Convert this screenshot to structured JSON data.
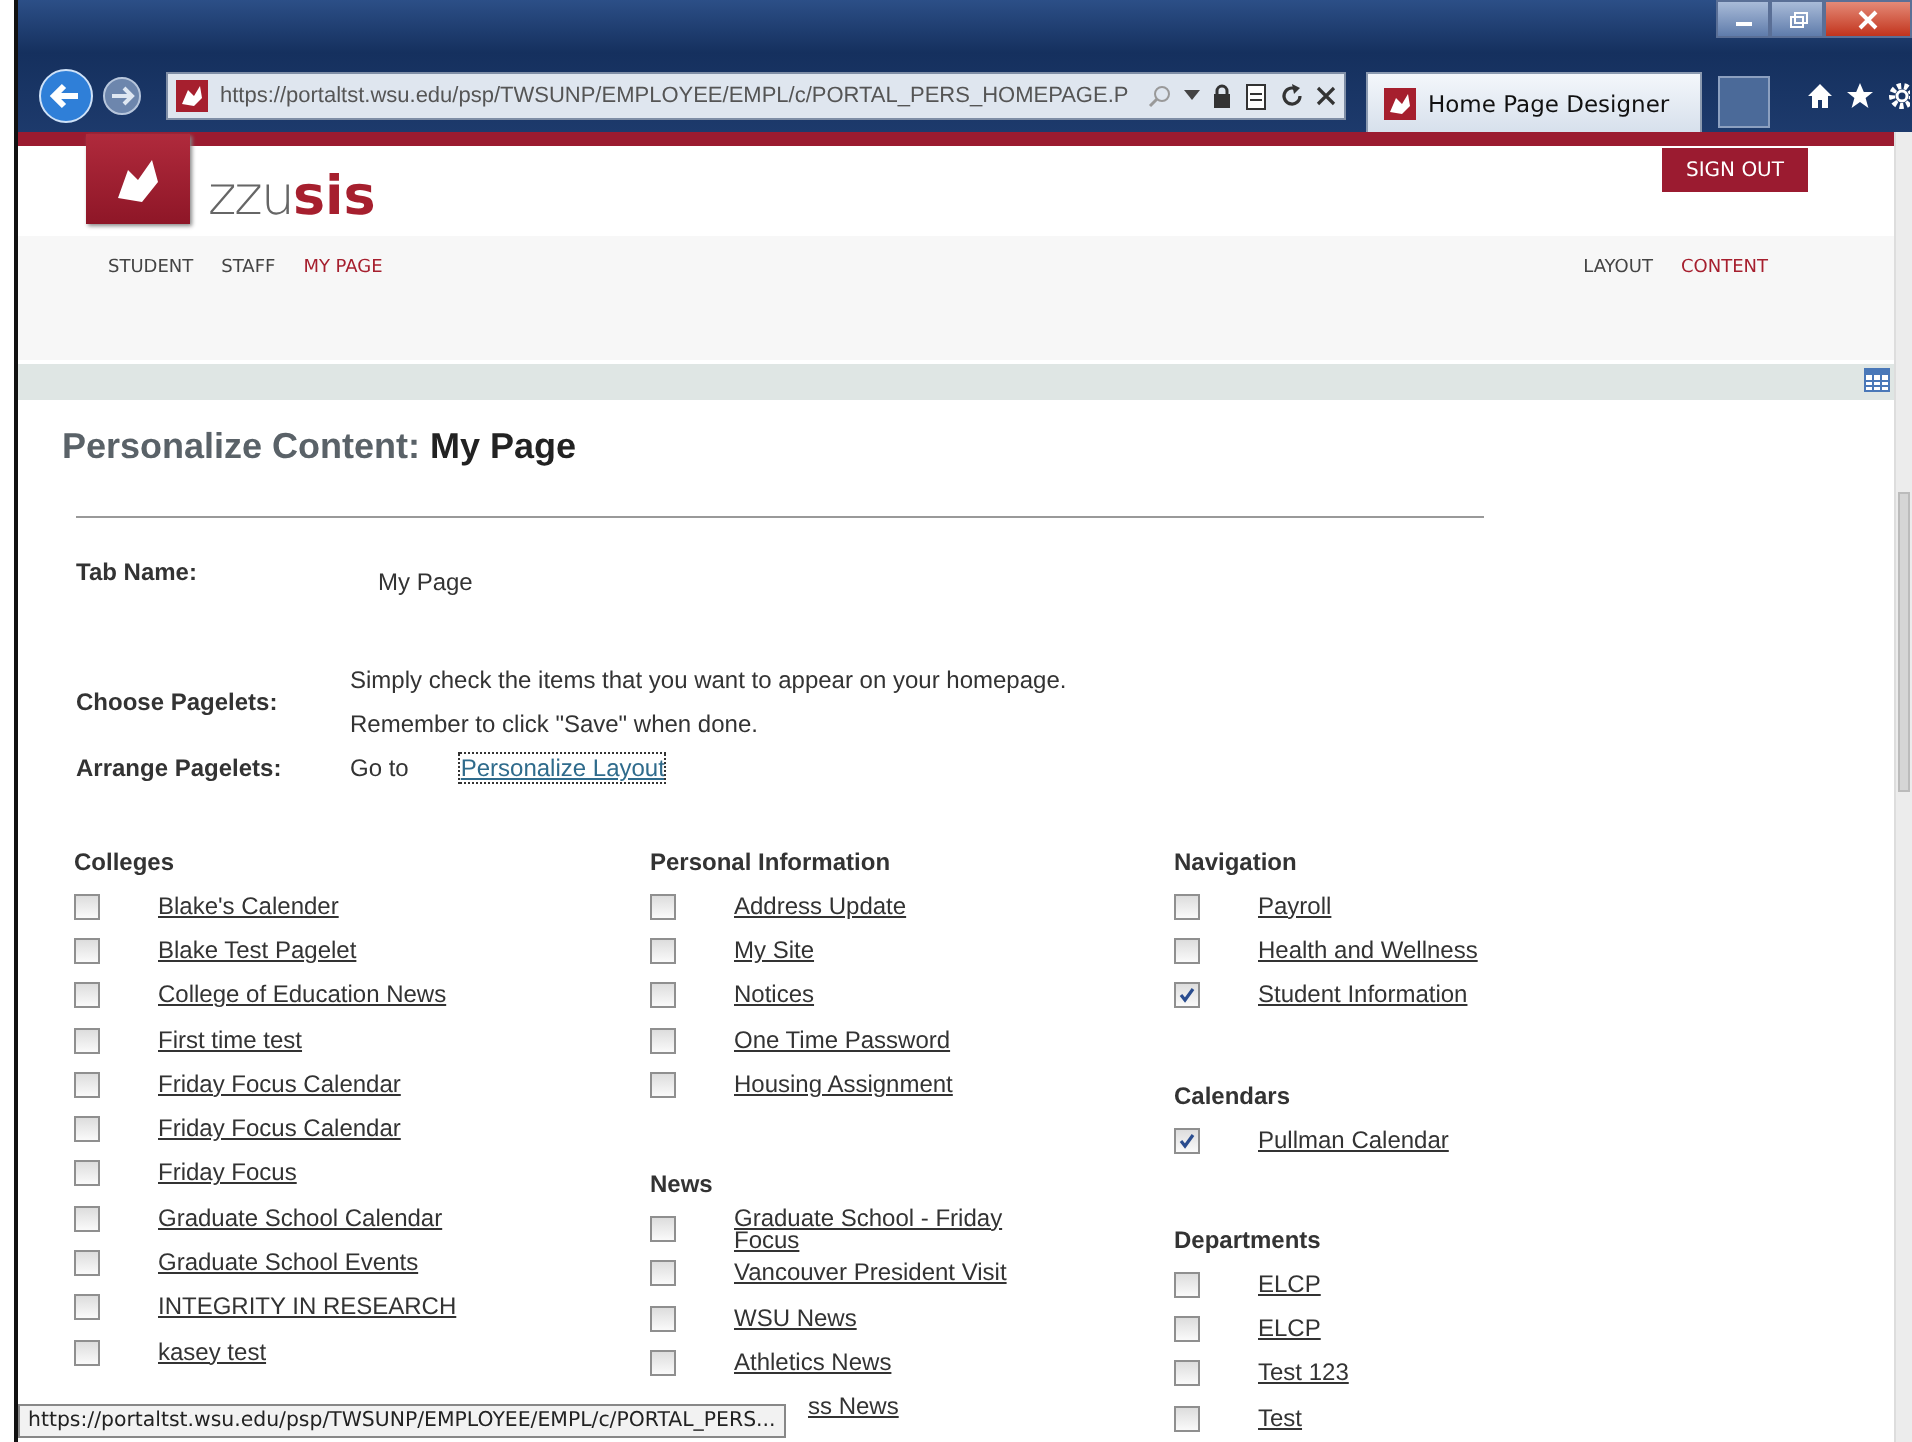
{
  "browser": {
    "address": "https://portaltst.wsu.edu/psp/TWSUNP/EMPLOYEE/EMPL/c/PORTAL_PERS_HOMEPAGE.P",
    "tab": {
      "label": "Home Page Designer",
      "selected": true
    }
  },
  "header": {
    "logo_light": "zzu",
    "logo_bold": "sis",
    "sign_out": "SIGN OUT"
  },
  "nav": {
    "left": [
      {
        "label": "STUDENT",
        "selected": false
      },
      {
        "label": "STAFF",
        "selected": false
      },
      {
        "label": "MY PAGE",
        "selected": true
      }
    ],
    "right": [
      {
        "label": "LAYOUT",
        "selected": false
      },
      {
        "label": "CONTENT",
        "selected": true
      }
    ]
  },
  "page": {
    "title_prefix": "Personalize Content:",
    "title_name": "My Page",
    "tab_name": {
      "label": "Tab Name:",
      "value": "My Page"
    },
    "choose": {
      "label": "Choose Pagelets:",
      "lines": [
        "Simply check the items that you want to appear on your homepage.",
        "Remember to click \"Save\" when done."
      ]
    },
    "arrange": {
      "label": "Arrange Pagelets:",
      "text": "Go to",
      "link": "Personalize Layout"
    }
  },
  "columns": [
    [
      {
        "title": "Colleges",
        "items": [
          {
            "label": "Blake's Calender",
            "checked": false
          },
          {
            "label": "Blake Test Pagelet",
            "checked": false
          },
          {
            "label": "College of Education News",
            "checked": false
          },
          {
            "label": "First time test",
            "checked": false
          },
          {
            "label": "Friday Focus Calendar",
            "checked": false
          },
          {
            "label": "Friday Focus Calendar",
            "checked": false
          },
          {
            "label": "Friday Focus",
            "checked": false
          },
          {
            "label": "Graduate School Calendar",
            "checked": false
          },
          {
            "label": "Graduate School Events",
            "checked": false
          },
          {
            "label": "INTEGRITY IN RESEARCH",
            "checked": false
          },
          {
            "label": "kasey test",
            "checked": false
          }
        ]
      }
    ],
    [
      {
        "title": "Personal Information",
        "items": [
          {
            "label": "Address Update",
            "checked": false
          },
          {
            "label": "My Site",
            "checked": false
          },
          {
            "label": "Notices",
            "checked": false
          },
          {
            "label": "One Time Password",
            "checked": false
          },
          {
            "label": "Housing Assignment",
            "checked": false
          }
        ]
      },
      {
        "title": "News",
        "items": [
          {
            "label": "Graduate School - Friday Focus",
            "checked": false
          },
          {
            "label": "Vancouver President Visit",
            "checked": false
          },
          {
            "label": "WSU News",
            "checked": false
          },
          {
            "label": "Athletics News",
            "checked": false
          },
          {
            "label": "ss News",
            "kind": "covered"
          }
        ]
      }
    ],
    [
      {
        "title": "Navigation",
        "items": [
          {
            "label": "Payroll",
            "checked": false
          },
          {
            "label": "Health and Wellness",
            "checked": false
          },
          {
            "label": "Student Information",
            "checked": true
          }
        ]
      },
      {
        "title": "Calendars",
        "items": [
          {
            "label": "Pullman Calendar",
            "checked": true
          }
        ]
      },
      {
        "title": "Departments",
        "items": [
          {
            "label": "ELCP",
            "checked": false
          },
          {
            "label": "ELCP",
            "checked": false
          },
          {
            "label": "Test 123",
            "checked": false
          },
          {
            "label": "Test",
            "checked": false
          }
        ]
      }
    ]
  ],
  "status_tooltip": "https://portaltst.wsu.edu/psp/TWSUNP/EMPLOYEE/EMPL/c/PORTAL_PERS..."
}
